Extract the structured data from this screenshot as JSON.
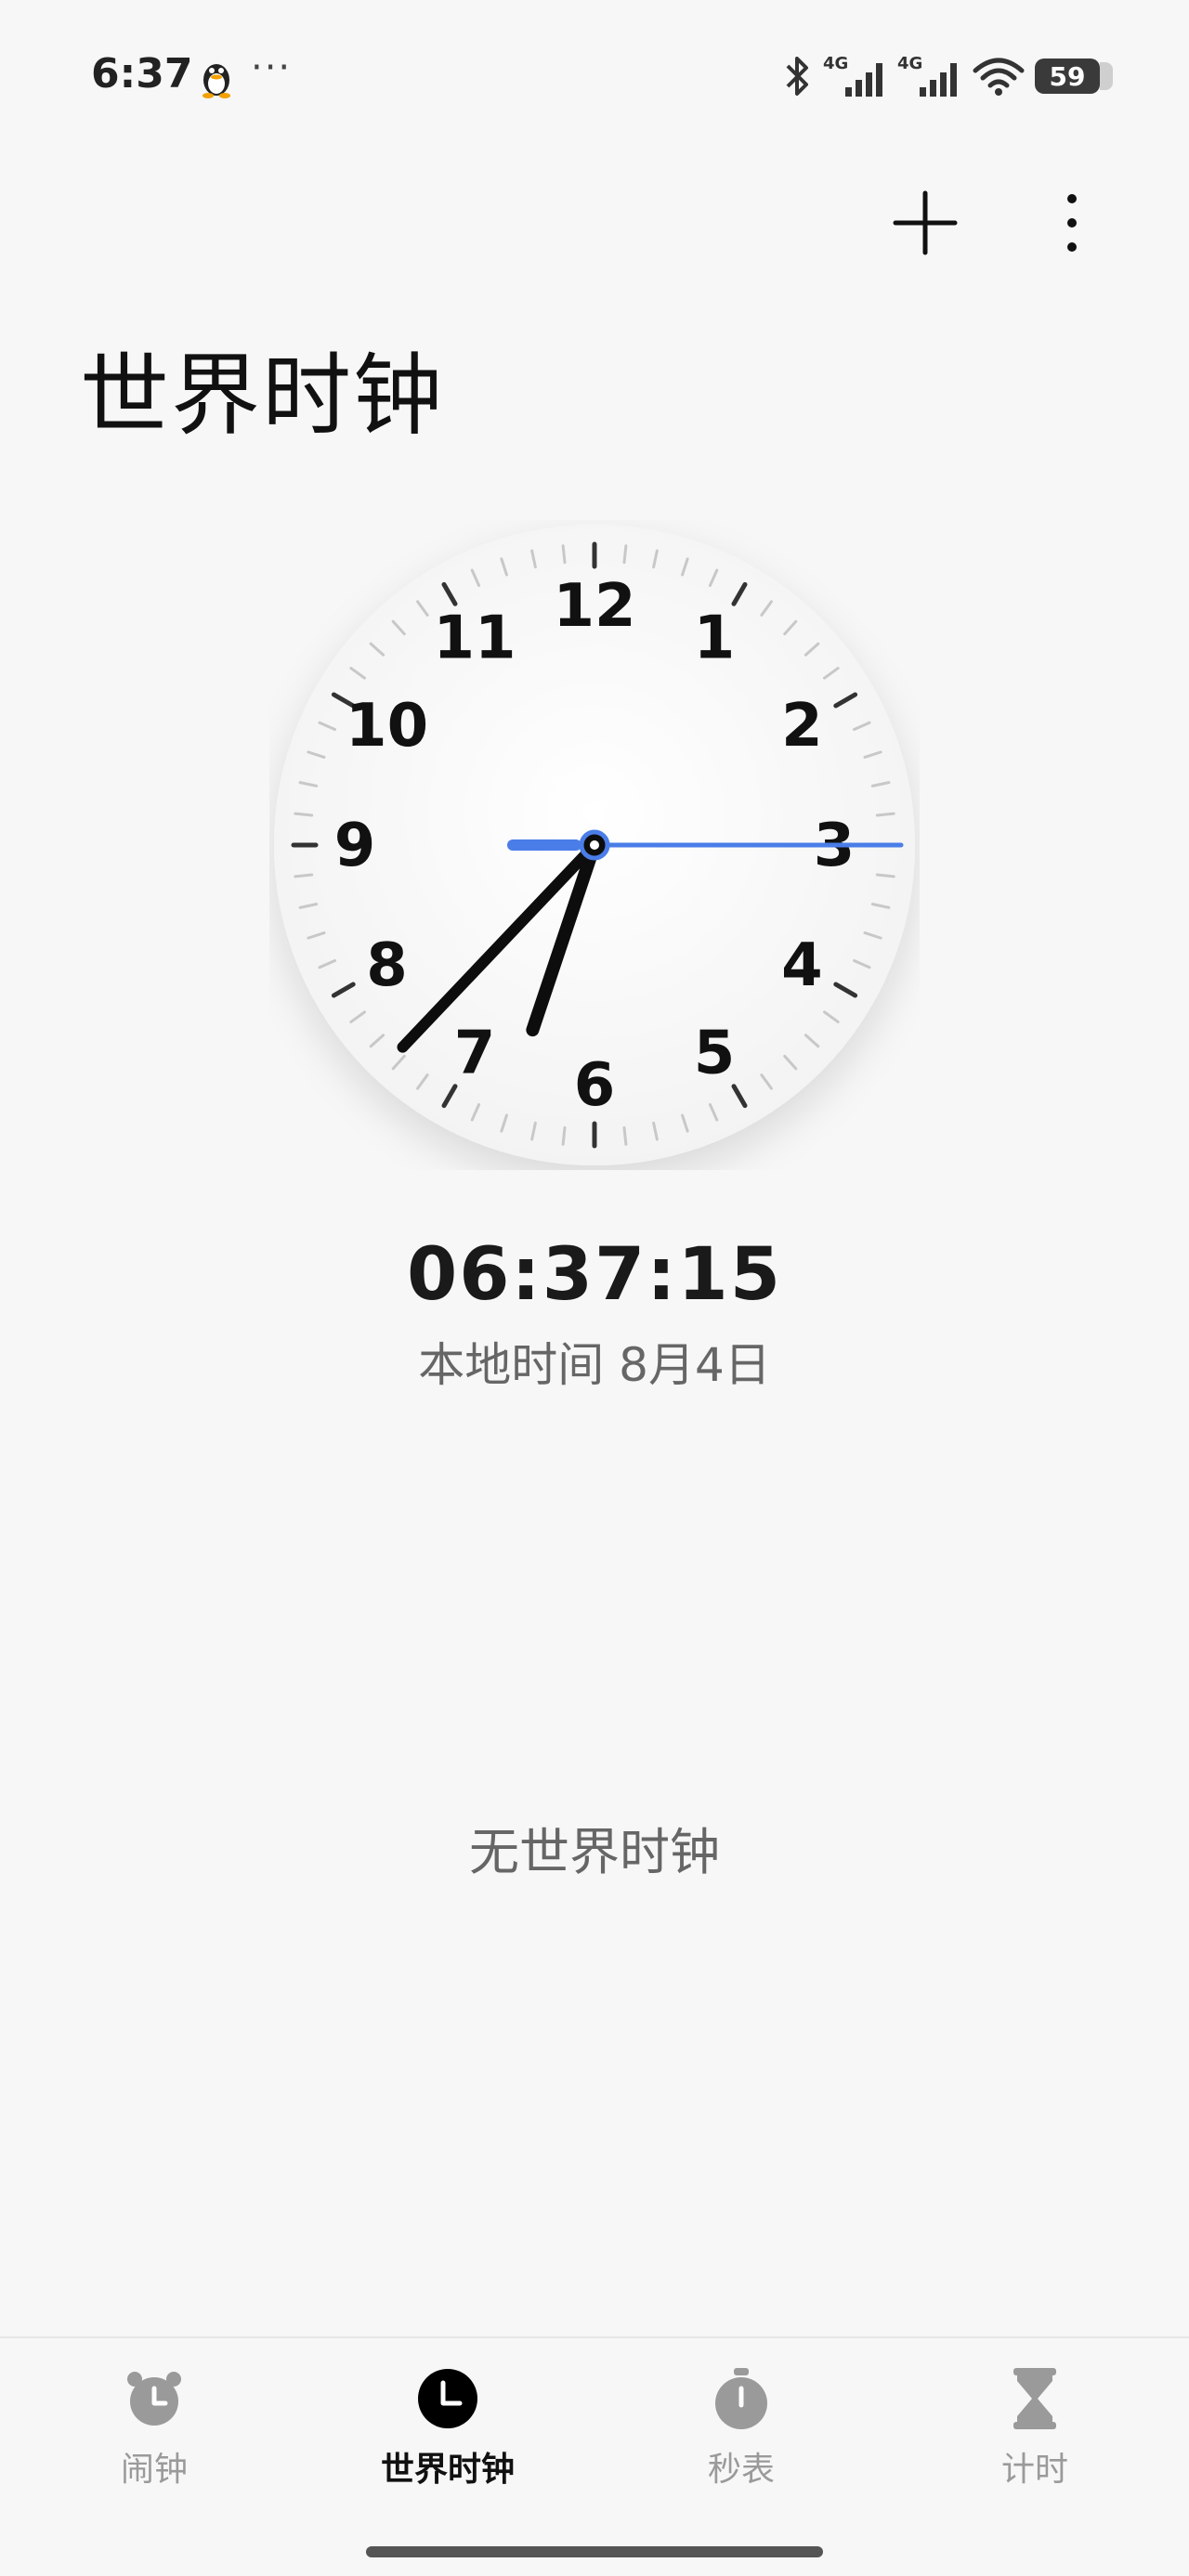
{
  "status_bar": {
    "time": "6:37",
    "more": "···",
    "network_1": "4G",
    "network_2": "4G",
    "battery": "59"
  },
  "header": {
    "title": "世界时钟"
  },
  "clock": {
    "numbers": [
      "12",
      "1",
      "2",
      "3",
      "4",
      "5",
      "6",
      "7",
      "8",
      "9",
      "10",
      "11"
    ],
    "hour": 6,
    "minute": 37,
    "second": 15,
    "accent_color": "#4a7de8"
  },
  "local": {
    "digital_time": "06:37:15",
    "date_label": "本地时间 8月4日"
  },
  "empty_state": {
    "text": "无世界时钟"
  },
  "bottom_nav": {
    "items": [
      {
        "label": "闹钟",
        "icon": "alarm-clock-icon",
        "active": false
      },
      {
        "label": "世界时钟",
        "icon": "clock-icon",
        "active": true
      },
      {
        "label": "秒表",
        "icon": "stopwatch-icon",
        "active": false
      },
      {
        "label": "计时",
        "icon": "hourglass-icon",
        "active": false
      }
    ]
  }
}
